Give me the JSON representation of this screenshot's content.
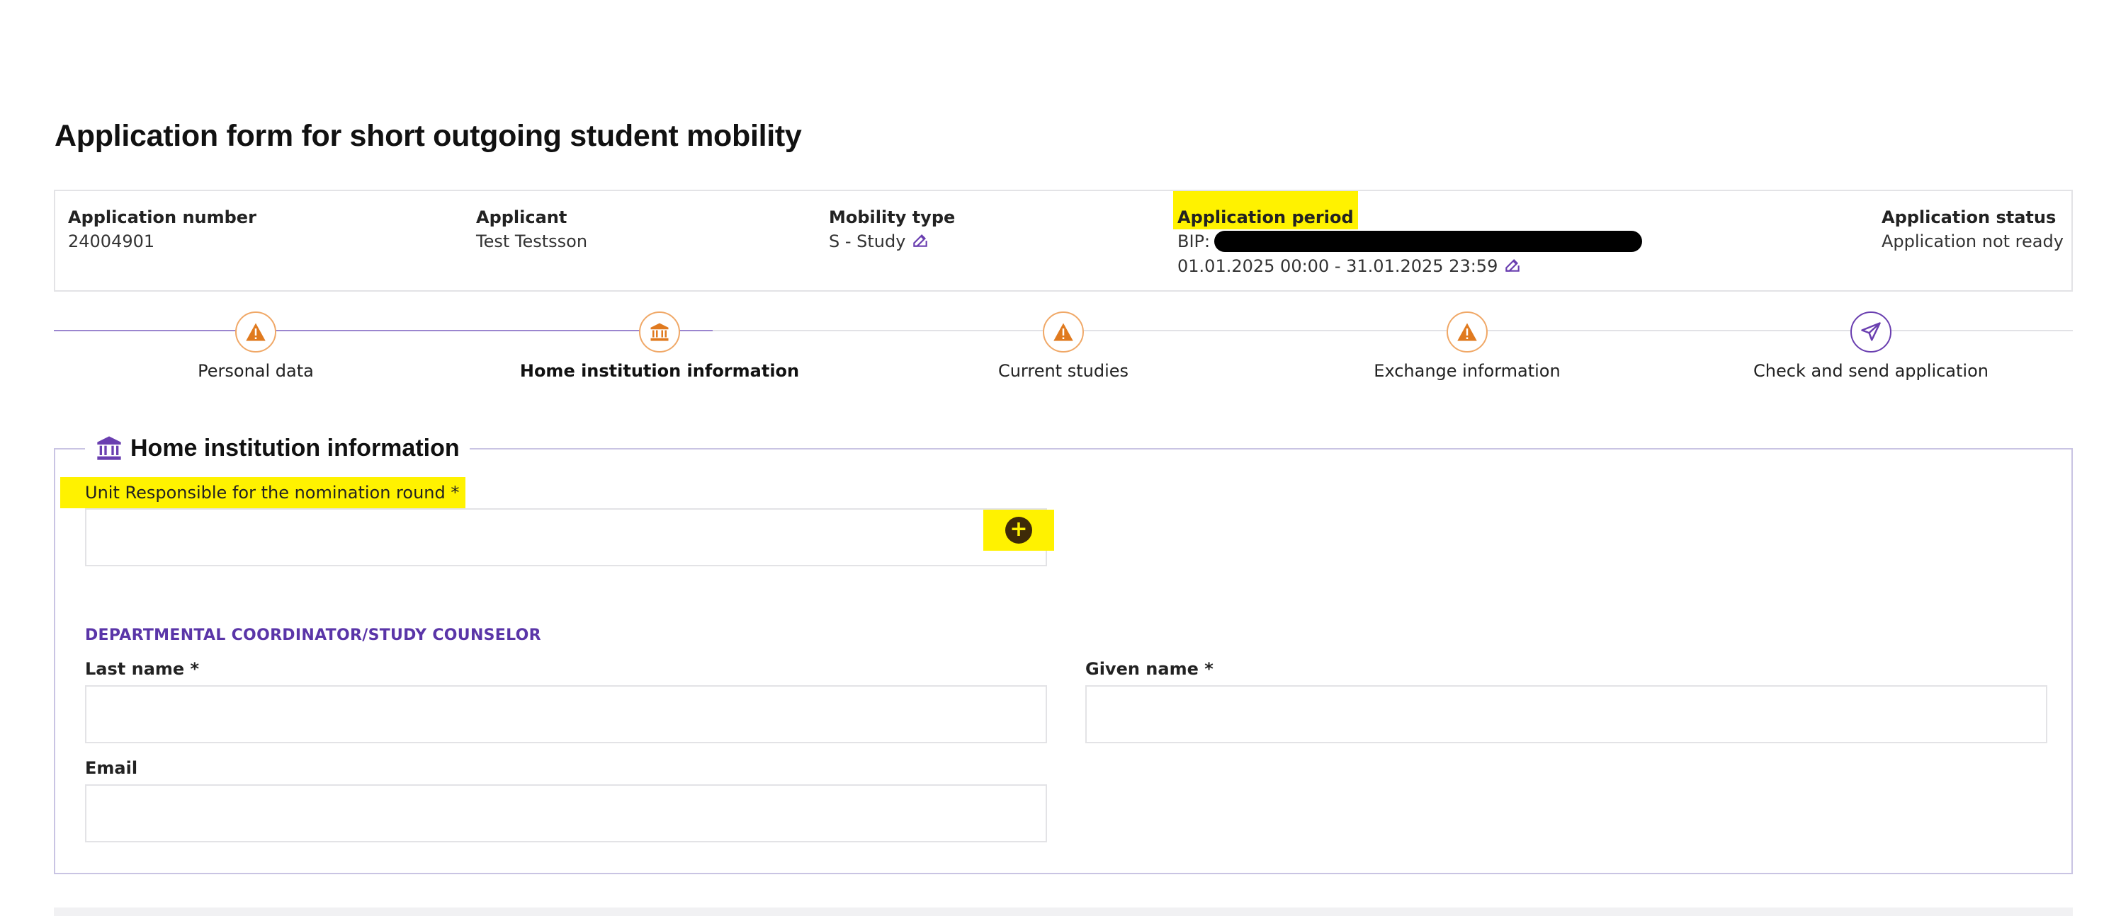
{
  "page": {
    "title": "Application form for short outgoing student mobility"
  },
  "info": {
    "application_number": {
      "label": "Application number",
      "value": "24004901"
    },
    "applicant": {
      "label": "Applicant",
      "value": "Test Testsson"
    },
    "mobility_type": {
      "label": "Mobility type",
      "value": "S - Study"
    },
    "application_period": {
      "label": "Application period",
      "program_prefix": "BIP:",
      "dates": "01.01.2025 00:00 - 31.01.2025 23:59"
    },
    "application_status": {
      "label": "Application status",
      "value": "Application not ready"
    }
  },
  "steps": [
    {
      "label": "Personal data",
      "icon": "warning-icon",
      "active": false
    },
    {
      "label": "Home institution information",
      "icon": "institution-icon",
      "active": true
    },
    {
      "label": "Current studies",
      "icon": "warning-icon",
      "active": false
    },
    {
      "label": "Exchange information",
      "icon": "warning-icon",
      "active": false
    },
    {
      "label": "Check and send application",
      "icon": "send-icon",
      "active": false
    }
  ],
  "section": {
    "title": "Home institution information",
    "icon": "institution-icon",
    "unit_field": {
      "label": "Unit Responsible for the nomination round *",
      "value": ""
    },
    "coordinator_heading": "DEPARTMENTAL COORDINATOR/STUDY COUNSELOR",
    "last_name": {
      "label": "Last name *",
      "value": ""
    },
    "given_name": {
      "label": "Given name *",
      "value": ""
    },
    "email": {
      "label": "Email",
      "value": ""
    }
  },
  "colors": {
    "accent_purple": "#6a3fb0",
    "warning_orange": "#e07a1f",
    "highlight_yellow": "#fff200"
  }
}
